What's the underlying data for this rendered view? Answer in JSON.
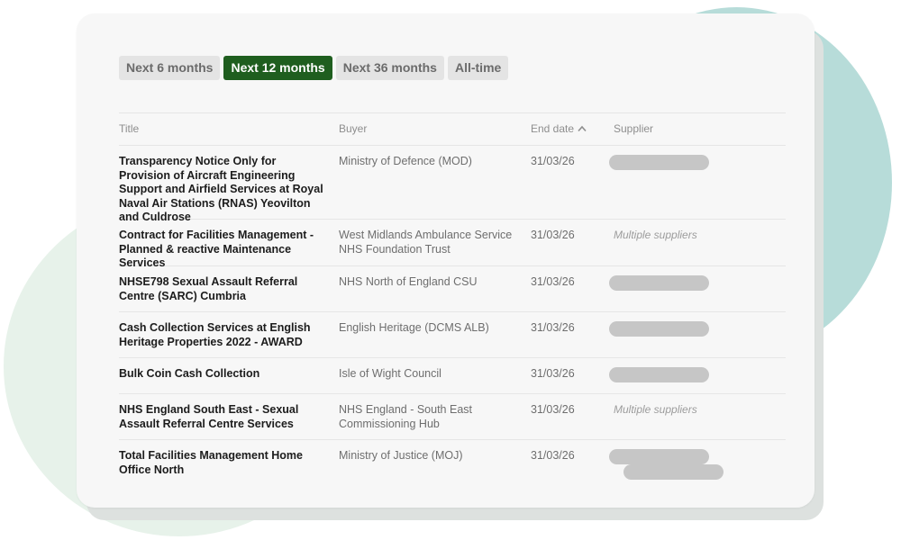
{
  "tabs": [
    {
      "label": "Next 6 months",
      "active": false
    },
    {
      "label": "Next 12 months",
      "active": true
    },
    {
      "label": "Next 36 months",
      "active": false
    },
    {
      "label": "All-time",
      "active": false
    }
  ],
  "columns": {
    "title": "Title",
    "buyer": "Buyer",
    "end_date": "End date",
    "supplier": "Supplier",
    "sort_icon": "chevron-up-icon"
  },
  "rows": [
    {
      "title": "Transparency Notice Only for Provision of Aircraft Engineering Support and Airfield Services at Royal Naval Air Stations (RNAS) Yeovilton and Culdrose",
      "buyer": "Ministry of Defence (MOD)",
      "end_date": "31/03/26",
      "supplier": "",
      "redactions": 1
    },
    {
      "title": "Contract for Facilities Management - Planned & reactive Maintenance Services",
      "buyer": "West Midlands Ambulance Service NHS Foundation Trust",
      "end_date": "31/03/26",
      "supplier": "Multiple suppliers",
      "redactions": 0
    },
    {
      "title": "NHSE798 Sexual Assault Referral Centre (SARC) Cumbria",
      "buyer": "NHS North of England CSU",
      "end_date": "31/03/26",
      "supplier": "",
      "redactions": 1
    },
    {
      "title": "Cash Collection Services at English Heritage Properties 2022 - AWARD",
      "buyer": "English Heritage (DCMS ALB)",
      "end_date": "31/03/26",
      "supplier": "",
      "redactions": 1
    },
    {
      "title": "Bulk Coin Cash Collection",
      "buyer": "Isle of Wight Council",
      "end_date": "31/03/26",
      "supplier": "",
      "redactions": 1
    },
    {
      "title": "NHS England South East - Sexual Assault Referral Centre Services",
      "buyer": "NHS England - South East Commissioning Hub",
      "end_date": "31/03/26",
      "supplier": "Multiple suppliers",
      "redactions": 0
    },
    {
      "title": "Total Facilities Management Home Office North",
      "buyer": "Ministry of Justice (MOJ)",
      "end_date": "31/03/26",
      "supplier": "",
      "redactions": 2
    }
  ],
  "colors": {
    "active_tab": "#1f5e1f",
    "redaction": "#c6c6c6",
    "blob_teal": "#b7dcd9",
    "blob_green": "#e7f2ea"
  }
}
